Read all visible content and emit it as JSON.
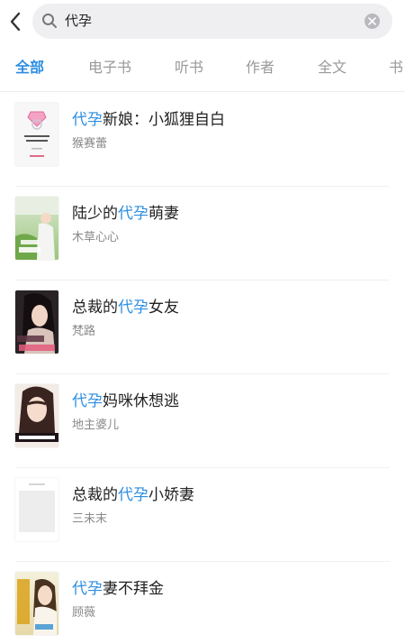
{
  "search": {
    "query": "代孕"
  },
  "tabs": [
    {
      "label": "全部",
      "active": true
    },
    {
      "label": "电子书",
      "active": false
    },
    {
      "label": "听书",
      "active": false
    },
    {
      "label": "作者",
      "active": false
    },
    {
      "label": "全文",
      "active": false
    },
    {
      "label": "书",
      "active": false
    }
  ],
  "results": [
    {
      "title_prefix": "",
      "title_highlight": "代孕",
      "title_suffix": "新娘：小狐狸自白",
      "author": "猴赛蕾",
      "cover_theme": "white-pink-ring"
    },
    {
      "title_prefix": "陆少的",
      "title_highlight": "代孕",
      "title_suffix": "萌妻",
      "author": "木草心心",
      "cover_theme": "green-outdoor"
    },
    {
      "title_prefix": "总裁的",
      "title_highlight": "代孕",
      "title_suffix": "女友",
      "author": "梵路",
      "cover_theme": "dark-portrait"
    },
    {
      "title_prefix": "",
      "title_highlight": "代孕",
      "title_suffix": "妈咪休想逃",
      "author": "地主婆儿",
      "cover_theme": "portrait-dark-banner"
    },
    {
      "title_prefix": "总裁的",
      "title_highlight": "代孕",
      "title_suffix": "小娇妻",
      "author": "三未末",
      "cover_theme": "blank-placeholder"
    },
    {
      "title_prefix": "",
      "title_highlight": "代孕",
      "title_suffix": "妻不拜金",
      "author": "顾薇",
      "cover_theme": "light-portrait"
    }
  ],
  "colors": {
    "accent": "#2c8ee2",
    "muted": "#999999"
  }
}
